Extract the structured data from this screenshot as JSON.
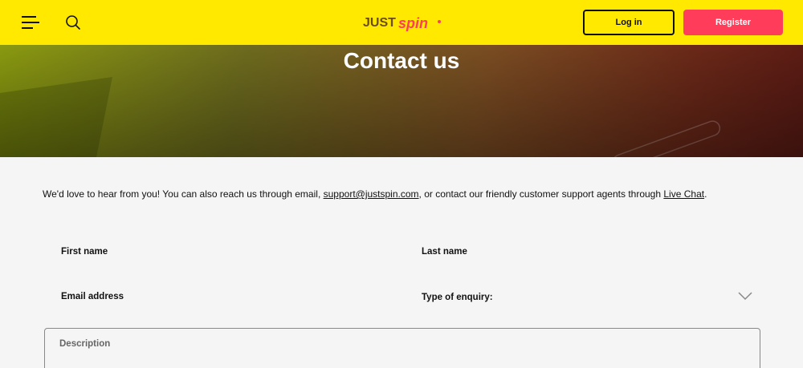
{
  "header": {
    "logo_text": "JUSTSPIN",
    "login_label": "Log in",
    "register_label": "Register",
    "colors": {
      "bar": "#ffe900",
      "register": "#ff3d5a",
      "logo_dark": "#6b4c1e",
      "logo_accent": "#ff3d5a"
    }
  },
  "hero": {
    "title": "Contact us"
  },
  "intro": {
    "text_before": "We'd love to hear from you! You can also reach us through email,",
    "email": "support@justspin.com",
    "text_middle": ", or contact our friendly customer support agents through",
    "chat_link": "Live Chat",
    "text_after": "."
  },
  "form": {
    "first_name_label": "First name",
    "last_name_label": "Last name",
    "email_label": "Email address",
    "enquiry_label": "Type of enquiry:",
    "description_placeholder": "Description"
  }
}
